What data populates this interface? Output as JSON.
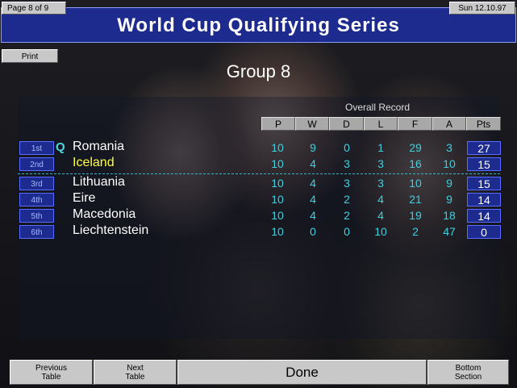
{
  "header": {
    "page_indicator": "Page 8 of 9",
    "date": "Sun 12.10.97",
    "title": "World Cup Qualifying Series"
  },
  "toolbar": {
    "print_label": "Print"
  },
  "group_title": "Group 8",
  "table": {
    "record_caption": "Overall Record",
    "columns": [
      "P",
      "W",
      "D",
      "L",
      "F",
      "A",
      "Pts"
    ],
    "rows": [
      {
        "pos": "1st",
        "q": "Q",
        "team": "Romania",
        "highlight": false,
        "P": "10",
        "W": "9",
        "D": "0",
        "L": "1",
        "F": "29",
        "A": "3",
        "Pts": "27"
      },
      {
        "pos": "2nd",
        "q": "",
        "team": "Iceland",
        "highlight": true,
        "P": "10",
        "W": "4",
        "D": "3",
        "L": "3",
        "F": "16",
        "A": "10",
        "Pts": "15"
      },
      {
        "pos": "3rd",
        "q": "",
        "team": "Lithuania",
        "highlight": false,
        "P": "10",
        "W": "4",
        "D": "3",
        "L": "3",
        "F": "10",
        "A": "9",
        "Pts": "15"
      },
      {
        "pos": "4th",
        "q": "",
        "team": "Eire",
        "highlight": false,
        "P": "10",
        "W": "4",
        "D": "2",
        "L": "4",
        "F": "21",
        "A": "9",
        "Pts": "14"
      },
      {
        "pos": "5th",
        "q": "",
        "team": "Macedonia",
        "highlight": false,
        "P": "10",
        "W": "4",
        "D": "2",
        "L": "4",
        "F": "19",
        "A": "18",
        "Pts": "14"
      },
      {
        "pos": "6th",
        "q": "",
        "team": "Liechtenstein",
        "highlight": false,
        "P": "10",
        "W": "0",
        "D": "0",
        "L": "10",
        "F": "2",
        "A": "47",
        "Pts": "0"
      }
    ]
  },
  "footer": {
    "previous_line1": "Previous",
    "previous_line2": "Table",
    "next_line1": "Next",
    "next_line2": "Table",
    "done_label": "Done",
    "bottom_line1": "Bottom",
    "bottom_line2": "Section"
  },
  "colors": {
    "title_bar": "#1d2a8e",
    "values": "#3fd0e0",
    "highlight_team": "#ffff40"
  }
}
